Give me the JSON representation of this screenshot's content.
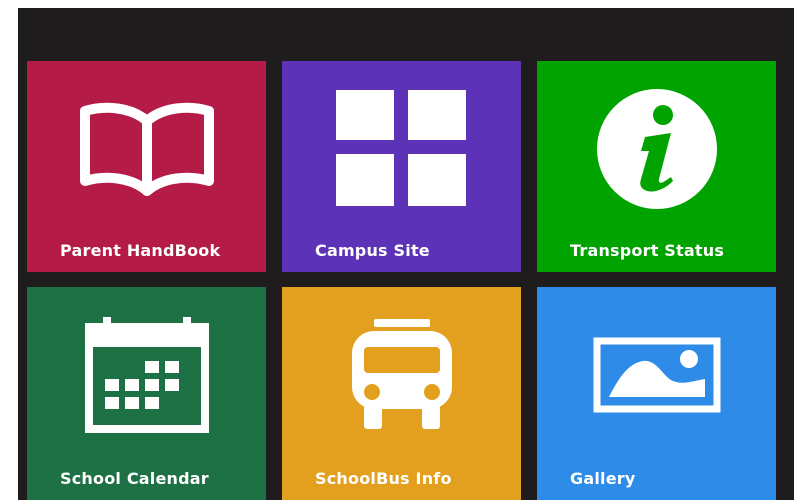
{
  "tiles": [
    {
      "id": "parent-handbook",
      "label": "Parent HandBook",
      "color": "#b51b47",
      "icon": "open-book-icon"
    },
    {
      "id": "campus-site",
      "label": "Campus Site",
      "color": "#5c33b6",
      "icon": "windows-grid-icon"
    },
    {
      "id": "transport-status",
      "label": "Transport Status",
      "color": "#00a300",
      "icon": "info-icon"
    },
    {
      "id": "school-calendar",
      "label": "School Calendar",
      "color": "#1e7145",
      "icon": "calendar-icon"
    },
    {
      "id": "schoolbus-info",
      "label": "SchoolBus Info",
      "color": "#e2a01e",
      "icon": "bus-icon"
    },
    {
      "id": "gallery",
      "label": "Gallery",
      "color": "#2e8be8",
      "icon": "image-icon"
    }
  ]
}
